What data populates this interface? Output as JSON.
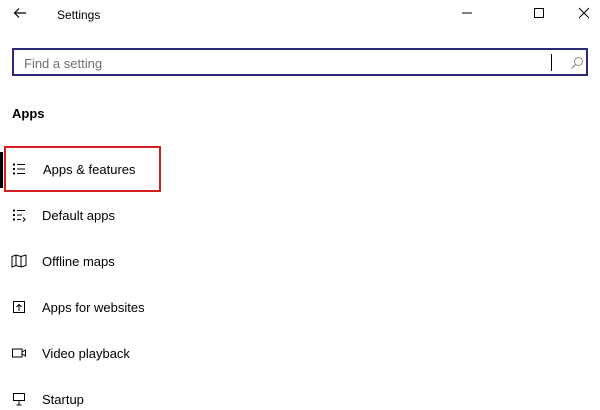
{
  "window": {
    "title": "Settings"
  },
  "search": {
    "value": "",
    "placeholder": "Find a setting"
  },
  "section": {
    "title": "Apps"
  },
  "nav": {
    "items": [
      {
        "label": "Apps & features",
        "icon": "list-icon",
        "selected": true
      },
      {
        "label": "Default apps",
        "icon": "default-apps-icon",
        "selected": false
      },
      {
        "label": "Offline maps",
        "icon": "map-icon",
        "selected": false
      },
      {
        "label": "Apps for websites",
        "icon": "open-in-icon",
        "selected": false
      },
      {
        "label": "Video playback",
        "icon": "video-icon",
        "selected": false
      },
      {
        "label": "Startup",
        "icon": "startup-icon",
        "selected": false
      }
    ]
  },
  "colors": {
    "search_border": "#2b2a7a",
    "highlight": "#d32020",
    "text": "#000000",
    "placeholder": "#6f6f6f"
  }
}
